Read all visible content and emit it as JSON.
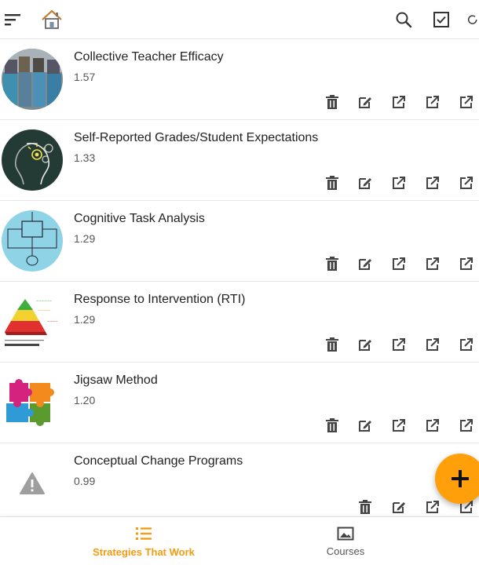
{
  "header": {
    "icons": [
      "menu-icon",
      "home-icon",
      "search-icon",
      "checkbox-icon",
      "refresh-icon"
    ]
  },
  "strategies": [
    {
      "title": "Collective Teacher Efficacy",
      "score": "1.57",
      "thumbnail": "teachers-photo"
    },
    {
      "title": "Self-Reported Grades/Student Expectations",
      "score": "1.33",
      "thumbnail": "lightbulb-head-chalkboard"
    },
    {
      "title": "Cognitive Task Analysis",
      "score": "1.29",
      "thumbnail": "flowchart-diagram"
    },
    {
      "title": "Response to Intervention (RTI)",
      "score": "1.29",
      "thumbnail": "rti-pyramid"
    },
    {
      "title": "Jigsaw Method",
      "score": "1.20",
      "thumbnail": "puzzle-pieces"
    },
    {
      "title": "Conceptual Change Programs",
      "score": "0.99",
      "thumbnail": "warning-placeholder"
    }
  ],
  "row_actions": [
    "delete-icon",
    "edit-icon",
    "open-external-icon",
    "open-external-icon",
    "open-external-icon"
  ],
  "fab": {
    "icon": "plus-icon",
    "color": "#ff9f0a"
  },
  "bottom_nav": {
    "items": [
      {
        "label": "Strategies That Work",
        "icon": "list-icon",
        "active": true
      },
      {
        "label": "Courses",
        "icon": "image-icon",
        "active": false
      }
    ],
    "active_color": "#f39c12"
  }
}
